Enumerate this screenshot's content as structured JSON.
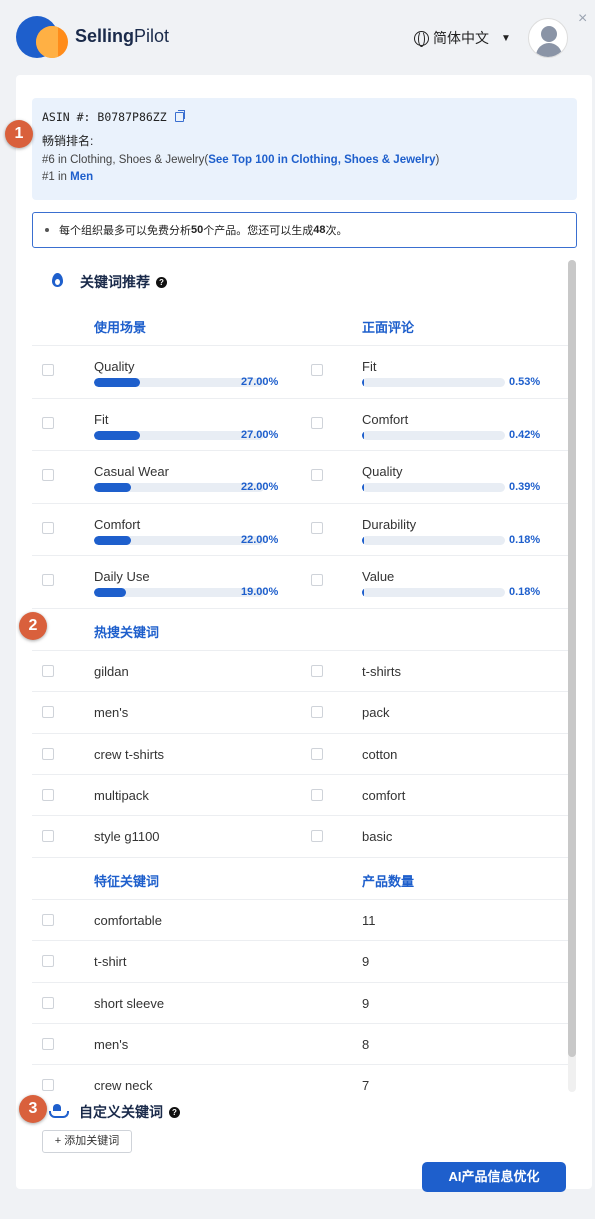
{
  "app": {
    "brand_bold": "Selling",
    "brand_rest": "Pilot",
    "close_icon": "×"
  },
  "header": {
    "language": "简体中文"
  },
  "product": {
    "asin_label": "ASIN #:",
    "asin": "B0787P86ZZ",
    "rank_label": "畅销排名:",
    "rank1_prefix": "#6 in Clothing, Shoes & Jewelry(",
    "rank1_link": "See Top 100 in Clothing, Shoes & Jewelry",
    "rank1_suffix": ")",
    "rank2_prefix": "#1 in ",
    "rank2_link": "Men"
  },
  "notice": {
    "pre": "每个组织最多可以免费分析",
    "n1": "50",
    "mid": "个产品。您还可以生成",
    "n2": "48",
    "post": "次。"
  },
  "keyword_section": {
    "title": "关键词推荐",
    "usage_header": "使用场景",
    "review_header": "正面评论",
    "usage": [
      {
        "label": "Quality",
        "pct_text": "27.00%",
        "pct": 27.0
      },
      {
        "label": "Fit",
        "pct_text": "27.00%",
        "pct": 27.0
      },
      {
        "label": "Casual Wear",
        "pct_text": "22.00%",
        "pct": 22.0
      },
      {
        "label": "Comfort",
        "pct_text": "22.00%",
        "pct": 22.0
      },
      {
        "label": "Daily Use",
        "pct_text": "19.00%",
        "pct": 19.0
      }
    ],
    "reviews": [
      {
        "label": "Fit",
        "pct_text": "0.53%",
        "pct": 0.53
      },
      {
        "label": "Comfort",
        "pct_text": "0.42%",
        "pct": 0.42
      },
      {
        "label": "Quality",
        "pct_text": "0.39%",
        "pct": 0.39
      },
      {
        "label": "Durability",
        "pct_text": "0.18%",
        "pct": 0.18
      },
      {
        "label": "Value",
        "pct_text": "0.18%",
        "pct": 0.18
      }
    ]
  },
  "hot_section": {
    "title": "热搜关键词",
    "left": [
      "gildan",
      "men's",
      "crew t-shirts",
      "multipack",
      "style g1100"
    ],
    "right": [
      "t-shirts",
      "pack",
      "cotton",
      "comfort",
      "basic"
    ]
  },
  "feature_section": {
    "keyword_header": "特征关键词",
    "count_header": "产品数量",
    "rows": [
      {
        "keyword": "comfortable",
        "count": "11"
      },
      {
        "keyword": "t-shirt",
        "count": "9"
      },
      {
        "keyword": "short sleeve",
        "count": "9"
      },
      {
        "keyword": "men's",
        "count": "8"
      },
      {
        "keyword": "crew neck",
        "count": "7"
      }
    ]
  },
  "custom_section": {
    "title": "自定义关键词",
    "add_button": "+ 添加关键词"
  },
  "footer": {
    "ai_button": "AI产品信息优化"
  },
  "badges": [
    "1",
    "2",
    "3"
  ],
  "colors": {
    "accent": "#1e5fcc",
    "badge": "#d9603c",
    "info_bg": "#eaf2fc"
  }
}
